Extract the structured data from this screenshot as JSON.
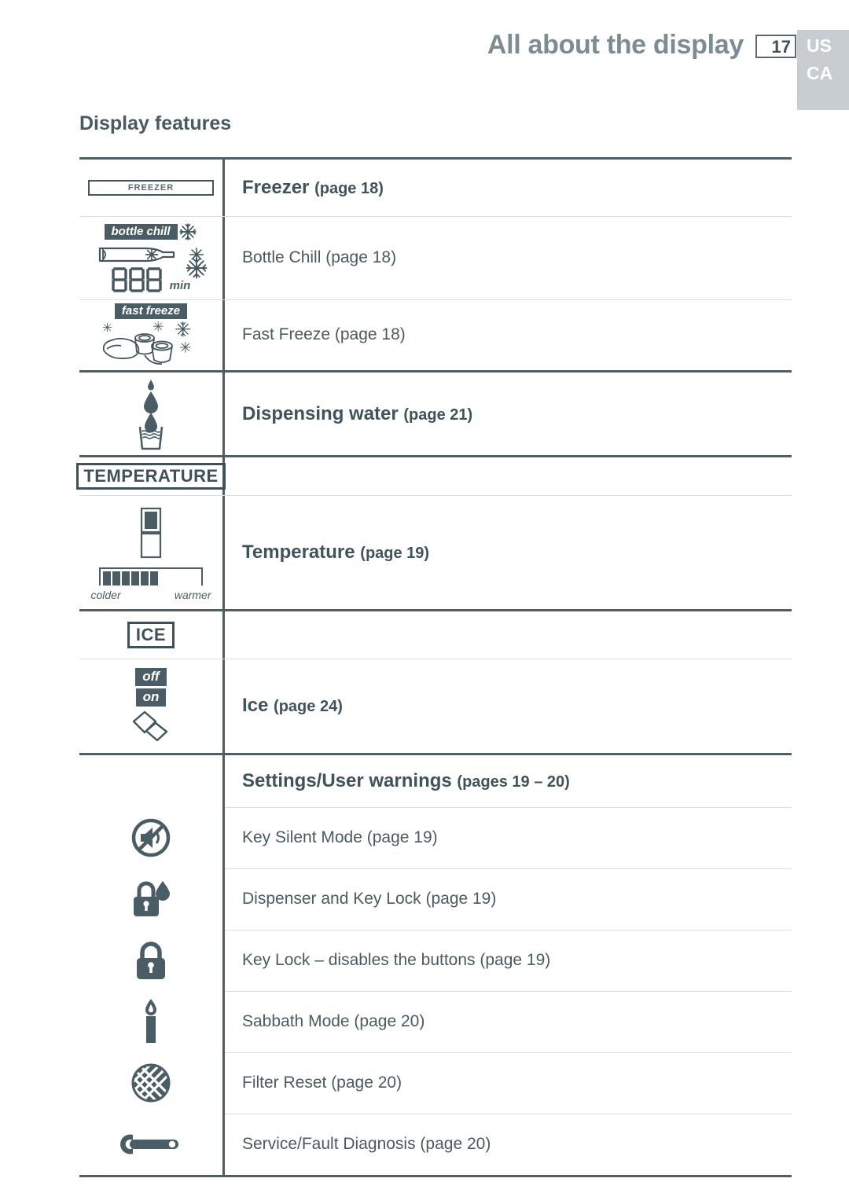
{
  "header": {
    "title": "All about the display",
    "page_number": "17",
    "region_line1": "US",
    "region_line2": "CA",
    "accent_grey": "#c8cdd1",
    "title_color": "#7d8c93"
  },
  "section": {
    "heading": "Display features"
  },
  "groups": [
    {
      "name": "freezer-group",
      "rows": [
        {
          "icon": "freezer-bar-icon",
          "icon_text": "FREEZER",
          "label": "Freezer",
          "page": "(page 18)",
          "style": "big"
        },
        {
          "icon": "bottle-chill-icon",
          "icon_tag": "bottle chill",
          "icon_digits": "888",
          "icon_unit": "min",
          "label": "Bottle Chill (page 18)",
          "style": "regular"
        },
        {
          "icon": "fast-freeze-icon",
          "icon_tag": "fast freeze",
          "label": "Fast Freeze (page 18)",
          "style": "regular"
        }
      ]
    },
    {
      "name": "dispensing-water-group",
      "rows": [
        {
          "icon": "water-dispense-icon",
          "label": "Dispensing water",
          "page": "(page 21)",
          "style": "big"
        }
      ]
    },
    {
      "name": "temperature-group",
      "rows": [
        {
          "icon": "temperature-label-icon",
          "icon_text": "TEMPERATURE",
          "label": "",
          "style": "none"
        },
        {
          "icon": "fridge-gauge-icon",
          "icon_left_label": "colder",
          "icon_right_label": "warmer",
          "label": "Temperature",
          "page": "(page 19)",
          "style": "big"
        }
      ]
    },
    {
      "name": "ice-group",
      "rows": [
        {
          "icon": "ice-label-icon",
          "icon_text": "ICE",
          "label": "",
          "style": "none"
        },
        {
          "icon": "ice-cubes-icon",
          "icon_tag_off": "off",
          "icon_tag_on": "on",
          "label": "Ice",
          "page": "(page 24)",
          "style": "big"
        }
      ]
    },
    {
      "name": "settings-group",
      "heading": {
        "label": "Settings/User warnings",
        "page": "(pages 19 – 20)"
      },
      "rows": [
        {
          "icon": "mute-icon",
          "label": "Key Silent Mode (page 19)"
        },
        {
          "icon": "lock-droplet-icon",
          "label": "Dispenser and Key Lock (page 19)"
        },
        {
          "icon": "lock-icon",
          "label": "Key Lock – disables the buttons (page 19)"
        },
        {
          "icon": "candle-icon",
          "label": "Sabbath Mode (page 20)"
        },
        {
          "icon": "filter-icon",
          "label": "Filter Reset (page 20)"
        },
        {
          "icon": "wrench-icon",
          "label": "Service/Fault Diagnosis (page 20)"
        }
      ]
    }
  ]
}
